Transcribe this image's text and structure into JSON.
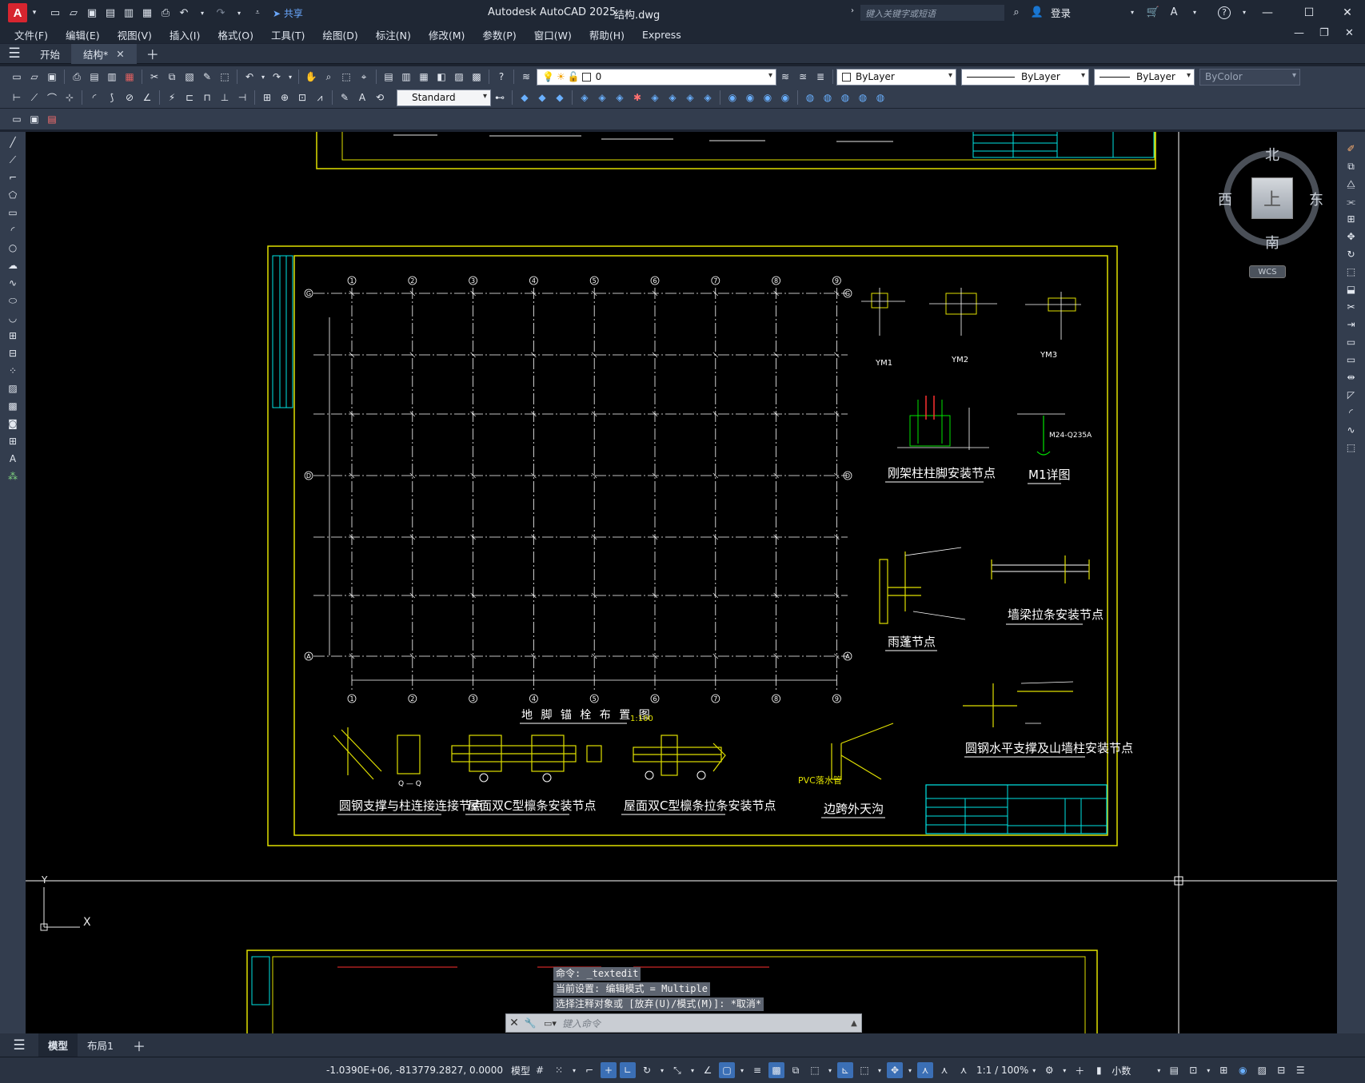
{
  "app": {
    "logo_letter": "A",
    "title": "Autodesk AutoCAD 2025",
    "file": "结构.dwg",
    "share_label": "共享",
    "search_placeholder": "键入关键字或短语",
    "login_label": "登录"
  },
  "menu": [
    "文件(F)",
    "编辑(E)",
    "视图(V)",
    "插入(I)",
    "格式(O)",
    "工具(T)",
    "绘图(D)",
    "标注(N)",
    "修改(M)",
    "参数(P)",
    "窗口(W)",
    "帮助(H)",
    "Express"
  ],
  "tabs": {
    "start": "开始",
    "active": "结构*"
  },
  "toolbar": {
    "layer_value": "0",
    "text_style": "Standard",
    "color": "ByLayer",
    "linetype": "ByLayer",
    "lineweight": "ByLayer",
    "plotstyle": "ByColor"
  },
  "viewcube": {
    "north": "北",
    "south": "南",
    "east": "东",
    "west": "西",
    "face": "上",
    "wcs": "WCS"
  },
  "drawing": {
    "plan_title": "地 脚 锚 栓 布 置 图",
    "plan_scale": "1:100",
    "grid_cols": [
      "1",
      "2",
      "3",
      "4",
      "5",
      "6",
      "7",
      "8",
      "9"
    ],
    "grid_rows": [
      "G",
      "D",
      "A"
    ],
    "details": {
      "ym1": "YM1",
      "ym2": "YM2",
      "ym3": "YM3",
      "column_base": "刚架柱柱脚安装节点",
      "m1": "M1详图",
      "m1_bolt": "M24-Q235A",
      "canopy": "雨蓬节点",
      "wall_purlin": "墙梁拉条安装节点",
      "horizontal_brace": "圆钢水平支撑及山墙柱安装节点",
      "round_brace": "圆钢支撑与柱连接连接节点",
      "roof_purlin": "屋面双C型檩条安装节点",
      "roof_purlin_brace": "屋面双C型檩条拉条安装节点",
      "gutter": "边跨外天沟",
      "gutter_pvc": "PVC落水管",
      "section_label": "Q — Q"
    }
  },
  "command": {
    "history": [
      "命令: _textedit",
      "当前设置: 编辑模式 = Multiple",
      "选择注释对象或 [放弃(U)/模式(M)]: *取消*"
    ],
    "placeholder": "键入命令"
  },
  "layout_tabs": {
    "model": "模型",
    "layout1": "布局1"
  },
  "status": {
    "coords": "-1.0390E+06, -813779.2827, 0.0000",
    "space": "模型",
    "scale": "1:1 / 100%",
    "units": "小数"
  }
}
